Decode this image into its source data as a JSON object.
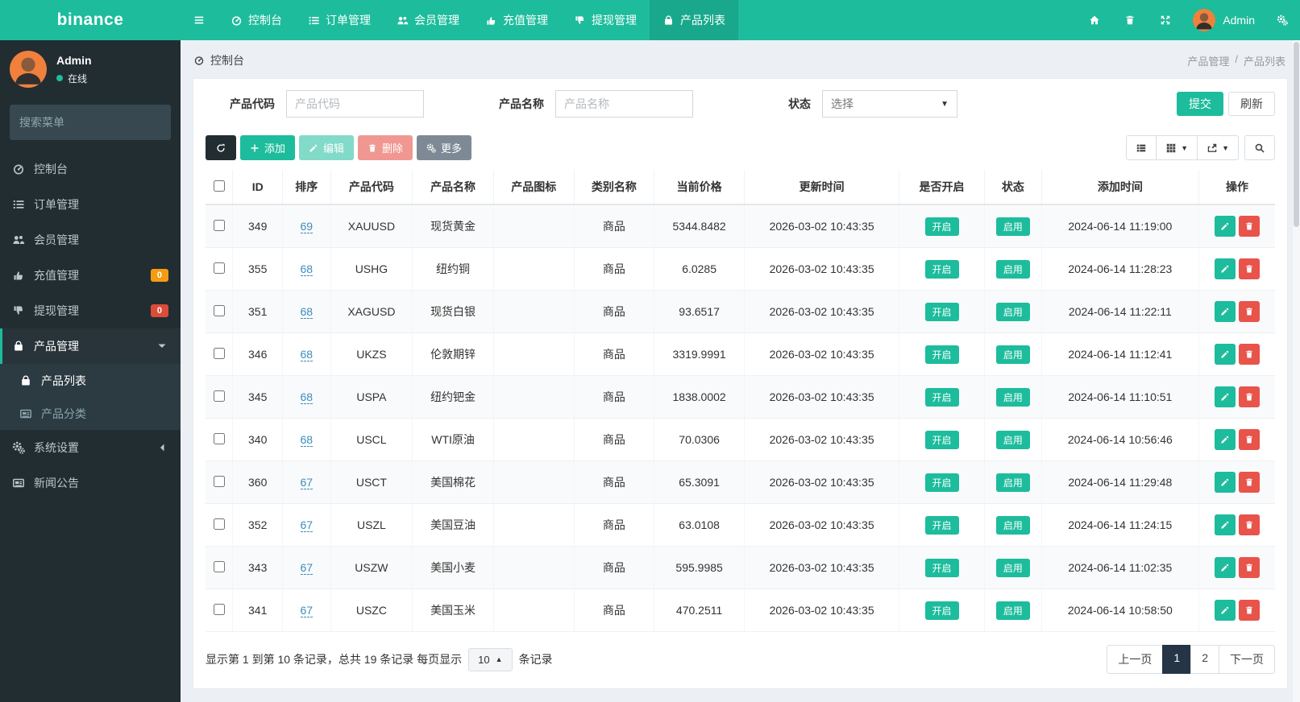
{
  "brand": "binance",
  "navbar": {
    "menu_items": [
      {
        "key": "dashboard",
        "label": "控制台",
        "icon": "tachometer-icon"
      },
      {
        "key": "orders",
        "label": "订单管理",
        "icon": "list-icon"
      },
      {
        "key": "members",
        "label": "会员管理",
        "icon": "users-icon"
      },
      {
        "key": "recharge",
        "label": "充值管理",
        "icon": "hand-up-icon"
      },
      {
        "key": "withdraw",
        "label": "提现管理",
        "icon": "hand-down-icon"
      },
      {
        "key": "products",
        "label": "产品列表",
        "icon": "bag-icon",
        "active": true
      }
    ],
    "user_name": "Admin"
  },
  "sidebar": {
    "user": {
      "name": "Admin",
      "status": "在线"
    },
    "search_placeholder": "搜索菜单",
    "items": [
      {
        "key": "dashboard",
        "label": "控制台",
        "icon": "tachometer-icon"
      },
      {
        "key": "orders",
        "label": "订单管理",
        "icon": "list-icon"
      },
      {
        "key": "members",
        "label": "会员管理",
        "icon": "users-icon"
      },
      {
        "key": "recharge",
        "label": "充值管理",
        "icon": "hand-up-icon",
        "badge": "0",
        "badge_color": "#f39c12"
      },
      {
        "key": "withdraw",
        "label": "提现管理",
        "icon": "hand-down-icon",
        "badge": "0",
        "badge_color": "#dd4b39"
      },
      {
        "key": "products",
        "label": "产品管理",
        "icon": "bag-icon",
        "active": true,
        "children": [
          {
            "key": "product-list",
            "label": "产品列表",
            "icon": "bag-icon",
            "current": true
          },
          {
            "key": "product-category",
            "label": "产品分类",
            "icon": "newspaper-icon",
            "current": false
          }
        ]
      },
      {
        "key": "settings",
        "label": "系统设置",
        "icon": "cogs-icon"
      },
      {
        "key": "news",
        "label": "新闻公告",
        "icon": "newspaper-icon"
      }
    ]
  },
  "breadcrumb": {
    "current": "控制台",
    "trail_1": "产品管理",
    "separator": "/",
    "trail_2": "产品列表"
  },
  "filters": {
    "code_label": "产品代码",
    "code_placeholder": "产品代码",
    "name_label": "产品名称",
    "name_placeholder": "产品名称",
    "status_label": "状态",
    "status_value": "选择",
    "submit": "提交",
    "refresh": "刷新"
  },
  "toolbar": {
    "add": "添加",
    "edit": "编辑",
    "delete": "删除",
    "more": "更多"
  },
  "table": {
    "headers": [
      "ID",
      "排序",
      "产品代码",
      "产品名称",
      "产品图标",
      "类别名称",
      "当前价格",
      "更新时间",
      "是否开启",
      "状态",
      "添加时间",
      "操作"
    ],
    "rows": [
      {
        "id": "349",
        "sort": "69",
        "code": "XAUUSD",
        "name": "现货黄金",
        "icon": "",
        "category": "商品",
        "price": "5344.8482",
        "updated": "2026-03-02 10:43:35",
        "enabled": "开启",
        "status": "启用",
        "added": "2024-06-14 11:19:00"
      },
      {
        "id": "355",
        "sort": "68",
        "code": "USHG",
        "name": "纽约铜",
        "icon": "",
        "category": "商品",
        "price": "6.0285",
        "updated": "2026-03-02 10:43:35",
        "enabled": "开启",
        "status": "启用",
        "added": "2024-06-14 11:28:23"
      },
      {
        "id": "351",
        "sort": "68",
        "code": "XAGUSD",
        "name": "现货白银",
        "icon": "",
        "category": "商品",
        "price": "93.6517",
        "updated": "2026-03-02 10:43:35",
        "enabled": "开启",
        "status": "启用",
        "added": "2024-06-14 11:22:11"
      },
      {
        "id": "346",
        "sort": "68",
        "code": "UKZS",
        "name": "伦敦期锌",
        "icon": "",
        "category": "商品",
        "price": "3319.9991",
        "updated": "2026-03-02 10:43:35",
        "enabled": "开启",
        "status": "启用",
        "added": "2024-06-14 11:12:41"
      },
      {
        "id": "345",
        "sort": "68",
        "code": "USPA",
        "name": "纽约钯金",
        "icon": "",
        "category": "商品",
        "price": "1838.0002",
        "updated": "2026-03-02 10:43:35",
        "enabled": "开启",
        "status": "启用",
        "added": "2024-06-14 11:10:51"
      },
      {
        "id": "340",
        "sort": "68",
        "code": "USCL",
        "name": "WTI原油",
        "icon": "",
        "category": "商品",
        "price": "70.0306",
        "updated": "2026-03-02 10:43:35",
        "enabled": "开启",
        "status": "启用",
        "added": "2024-06-14 10:56:46"
      },
      {
        "id": "360",
        "sort": "67",
        "code": "USCT",
        "name": "美国棉花",
        "icon": "",
        "category": "商品",
        "price": "65.3091",
        "updated": "2026-03-02 10:43:35",
        "enabled": "开启",
        "status": "启用",
        "added": "2024-06-14 11:29:48"
      },
      {
        "id": "352",
        "sort": "67",
        "code": "USZL",
        "name": "美国豆油",
        "icon": "",
        "category": "商品",
        "price": "63.0108",
        "updated": "2026-03-02 10:43:35",
        "enabled": "开启",
        "status": "启用",
        "added": "2024-06-14 11:24:15"
      },
      {
        "id": "343",
        "sort": "67",
        "code": "USZW",
        "name": "美国小麦",
        "icon": "",
        "category": "商品",
        "price": "595.9985",
        "updated": "2026-03-02 10:43:35",
        "enabled": "开启",
        "status": "启用",
        "added": "2024-06-14 11:02:35"
      },
      {
        "id": "341",
        "sort": "67",
        "code": "USZC",
        "name": "美国玉米",
        "icon": "",
        "category": "商品",
        "price": "470.2511",
        "updated": "2026-03-02 10:43:35",
        "enabled": "开启",
        "status": "启用",
        "added": "2024-06-14 10:58:50"
      }
    ]
  },
  "grid_footer": {
    "summary_prefix": "显示第 1 到第 10 条记录，总共 19 条记录 每页显示",
    "page_size": "10",
    "summary_suffix": "条记录"
  },
  "pagination": {
    "prev": "上一页",
    "page_1": "1",
    "page_2": "2",
    "next": "下一页",
    "active": "1"
  },
  "colors": {
    "accent": "#1dbc9c",
    "sidebar": "#222d32",
    "danger": "#e8534a",
    "warning": "#f39c12",
    "link": "#3c8dbc",
    "page_bg": "#ecf0f5",
    "pager_active": "#253546"
  }
}
